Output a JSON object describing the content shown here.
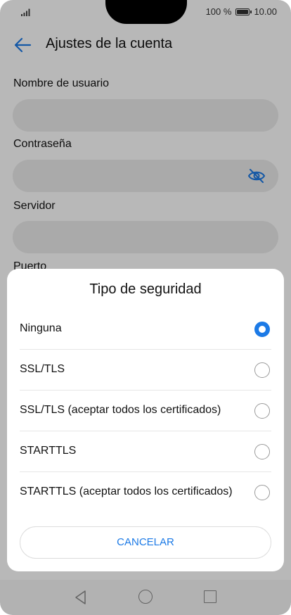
{
  "status_bar": {
    "battery_percent": "100 %",
    "time": "10.00"
  },
  "app_bar": {
    "title": "Ajustes de la cuenta"
  },
  "form": {
    "fields": [
      {
        "label": "Nombre de usuario",
        "value": ""
      },
      {
        "label": "Contraseña",
        "value": ""
      },
      {
        "label": "Servidor",
        "value": ""
      },
      {
        "label": "Puerto",
        "value": ""
      }
    ]
  },
  "dialog": {
    "title": "Tipo de seguridad",
    "options": [
      {
        "label": "Ninguna",
        "selected": true
      },
      {
        "label": "SSL/TLS",
        "selected": false
      },
      {
        "label": "SSL/TLS (aceptar todos los certificados)",
        "selected": false
      },
      {
        "label": "STARTTLS",
        "selected": false
      },
      {
        "label": "STARTTLS (aceptar todos los certificados)",
        "selected": false
      }
    ],
    "cancel_label": "CANCELAR"
  },
  "colors": {
    "accent": "#1c7ae6",
    "field_background": "#ececec"
  },
  "icons": {
    "back": "arrow-left-icon",
    "password_visibility": "eye-slash-icon"
  }
}
